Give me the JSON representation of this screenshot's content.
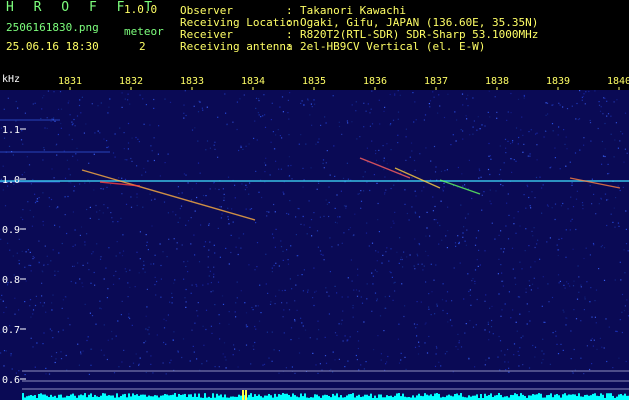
{
  "header": {
    "app_title": "H R O F F T",
    "version": "1.0.0",
    "filename": "2506161830.png",
    "meteor_label": "meteor",
    "datetime": "25.06.16 18:30",
    "meteor_count": "2",
    "info": [
      {
        "label": "Observer",
        "sep": ":",
        "value": "Takanori Kawachi"
      },
      {
        "label": "Receiving Location",
        "sep": ":",
        "value": "Ogaki, Gifu, JAPAN (136.60E, 35.35N)"
      },
      {
        "label": "Receiver",
        "sep": ":",
        "value": "R820T2(RTL-SDR) SDR-Sharp 53.1000MHz"
      },
      {
        "label": "Receiving antenna",
        "sep": ":",
        "value": "2el-HB9CV Vertical (el. E-W)"
      }
    ]
  },
  "spectrogram": {
    "unit_label": "kHz",
    "time_ticks": [
      "1831",
      "1832",
      "1833",
      "1834",
      "1835",
      "1836",
      "1837",
      "1838",
      "1839",
      "1840"
    ],
    "freq_ticks": [
      "1.1",
      "1.0",
      "0.9",
      "0.8",
      "0.7",
      "0.6"
    ],
    "colors": {
      "background": "#0a0a55",
      "carrier": "#40e0ff",
      "scale_text": "#ffff66",
      "axis_text": "#ffffff",
      "strip": "#00ffff"
    }
  }
}
